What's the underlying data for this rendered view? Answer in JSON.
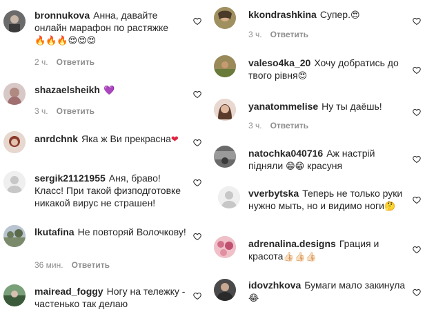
{
  "left_comments": [
    {
      "username": "bronnukova",
      "text": "Анна, давайте онлайн марафон по растяжке",
      "emoji": "🔥🔥🔥😍😍😍",
      "time": "2 ч.",
      "reply": "Ответить",
      "avatar": "#6b6b6b"
    },
    {
      "username": "shazaelsheikh",
      "text": "",
      "emoji": "💜",
      "time": "3 ч.",
      "reply": "Ответить",
      "avatar": "#c9b4b8"
    },
    {
      "username": "anrdchnk",
      "text": "Яка ж Ви прекрасна",
      "emoji": "❤",
      "time": "",
      "reply": "",
      "avatar": "#8a3a2a"
    },
    {
      "username": "sergik21121955",
      "text": "Аня, браво! Класс! При такой физподготовке никакой вирус не страшен!",
      "emoji": "",
      "time": "",
      "reply": "",
      "avatar": "#dbdbdb"
    },
    {
      "username": "lkutafina",
      "text": "Не повторяй Волочкову!",
      "emoji": "",
      "time": "36 мин.",
      "reply": "Ответить",
      "avatar": "#7a8a6a"
    },
    {
      "username": "mairead_foggy",
      "text": "Ногу на тележку - частенько так делаю",
      "emoji": "",
      "time": "",
      "reply": "",
      "avatar": "#4a6a4a"
    }
  ],
  "right_comments": [
    {
      "username": "kkondrashkina",
      "text": "Супер.",
      "emoji": "😍",
      "time": "3 ч.",
      "reply": "Ответить",
      "avatar": "#8a7a4a"
    },
    {
      "username": "valeso4ka_20",
      "text": "Хочу добратись до твого рівня",
      "emoji": "😍",
      "time": "",
      "reply": "",
      "avatar": "#8a6a3a"
    },
    {
      "username": "yanatommelise",
      "text": "Ну ты даёшь!",
      "emoji": "",
      "time": "3 ч.",
      "reply": "Ответить",
      "avatar": "#a07060"
    },
    {
      "username": "natochka040716",
      "text": "Аж настрій підняли",
      "emoji": "😁😁",
      "text2": "красуня",
      "time": "",
      "reply": "",
      "avatar": "#5a5a5a"
    },
    {
      "username": "vverbytska",
      "text": "Теперь не только руки нужно мыть, но и видимо ноги",
      "emoji": "🤔",
      "time": "",
      "reply": "",
      "avatar": "#dbdbdb"
    },
    {
      "username": "adrenalina.designs",
      "text": "Грация и красота",
      "emoji": "👍🏻👍🏻👍🏻",
      "time": "",
      "reply": "",
      "avatar": "#c07080"
    },
    {
      "username": "idovzhkova",
      "text": "Бумаги мало закинула",
      "emoji": "😂",
      "time": "",
      "reply": "",
      "avatar": "#3a3a3a"
    }
  ],
  "icons": {
    "heart": "heart-outline-icon"
  },
  "colors": {
    "text": "#262626",
    "muted": "#8e8e8e",
    "heart_stroke": "#262626"
  }
}
